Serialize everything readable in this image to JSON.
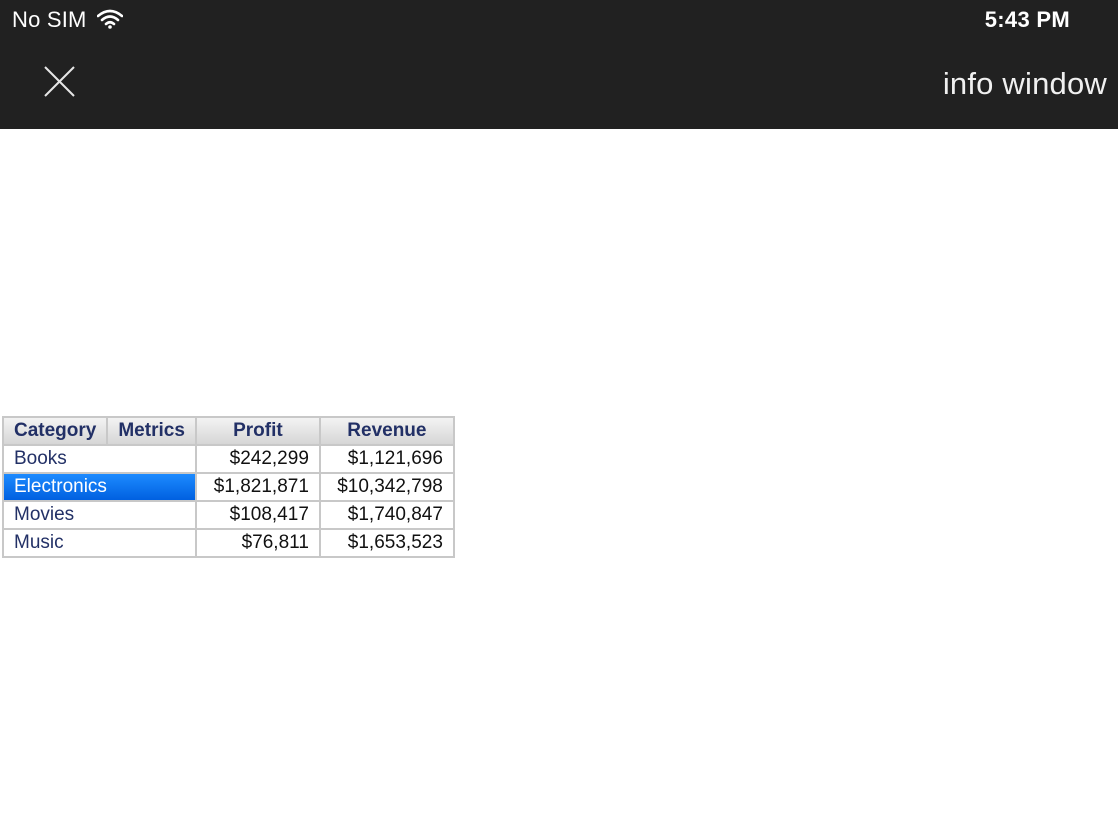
{
  "status_bar": {
    "carrier": "No SIM",
    "wifi_icon": "wifi-icon",
    "time": "5:43 PM"
  },
  "header": {
    "close_icon": "close-icon",
    "title": "info window"
  },
  "grid": {
    "headers": [
      "Category",
      "Metrics",
      "Profit",
      "Revenue"
    ],
    "rows": [
      {
        "category": "Books",
        "profit": "$242,299",
        "revenue": "$1,121,696",
        "selected": false
      },
      {
        "category": "Electronics",
        "profit": "$1,821,871",
        "revenue": "$10,342,798",
        "selected": true
      },
      {
        "category": "Movies",
        "profit": "$108,417",
        "revenue": "$1,740,847",
        "selected": false
      },
      {
        "category": "Music",
        "profit": "$76,811",
        "revenue": "$1,653,523",
        "selected": false
      }
    ],
    "colors": {
      "header_text": "#223066",
      "selected_bg": "#0a74f5",
      "border": "#c8c8c8"
    }
  }
}
